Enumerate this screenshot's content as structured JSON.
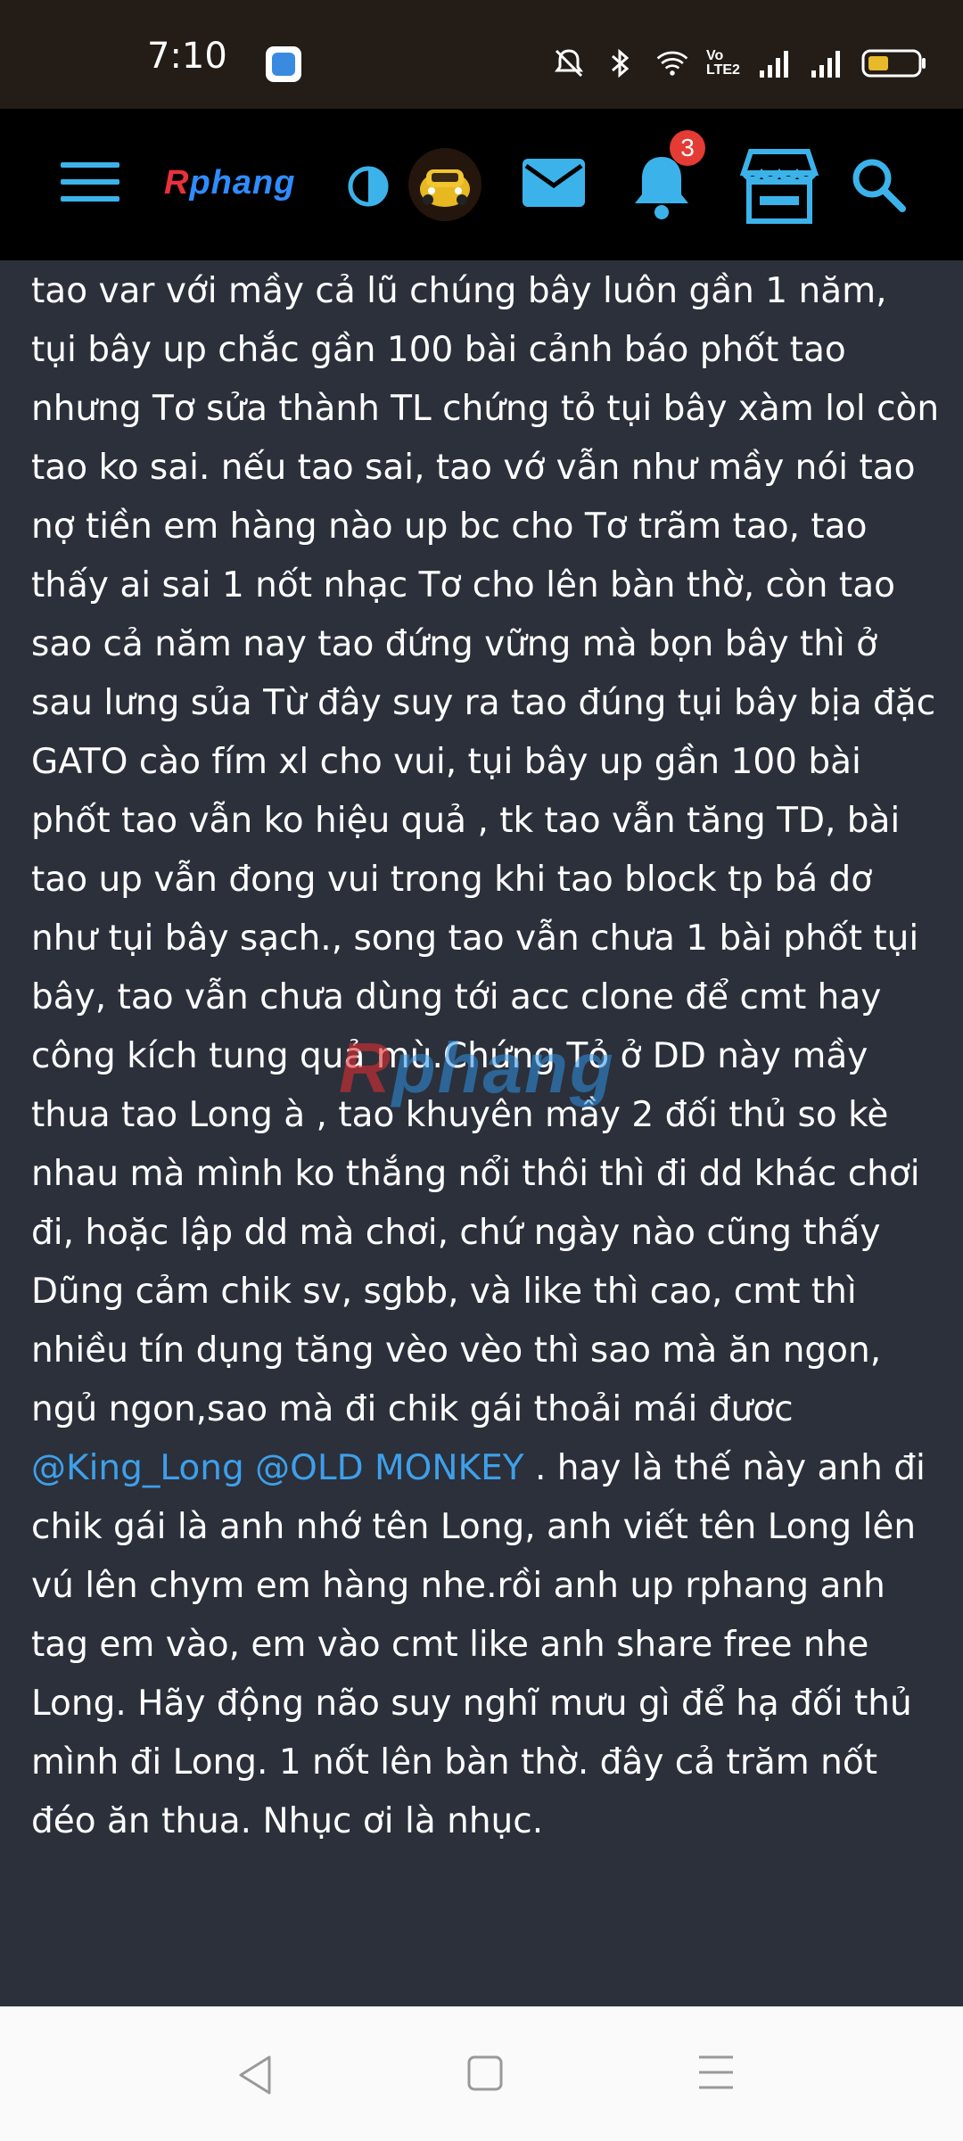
{
  "status_bar": {
    "time": "7:10",
    "network_label": "Vo LTE2",
    "icons": [
      "mute-icon",
      "bluetooth-icon",
      "wifi-icon",
      "volte-icon",
      "signal-icon",
      "signal-icon",
      "battery-icon"
    ]
  },
  "header": {
    "logo": "Rphang",
    "logo_first": "R",
    "logo_rest": "phang",
    "notification_count": "3",
    "accent_color": "#3bb3ea",
    "icons": [
      "menu-icon",
      "contrast-icon",
      "avatar",
      "mail-icon",
      "bell-icon",
      "store-icon",
      "search-icon"
    ]
  },
  "post": {
    "text_before": "tao var với mầy cả lũ chúng bây luôn gần 1 năm, tụi bây up chắc gần 100 bài cảnh báo phốt tao nhưng Tơ sửa thành TL chứng tỏ tụi bây xàm lol còn tao ko sai. nếu tao sai, tao vớ vẫn như mầy nói tao nợ tiền em hàng nào up bc cho Tơ trãm tao, tao thấy ai sai 1 nốt nhạc Tơ cho lên bàn thờ, còn tao sao cả năm nay tao đứng vững mà bọn bây thì ở sau lưng sủa Từ đây suy ra tao đúng tụi bây bịa đặc GATO cào fím xl cho vui, tụi bây up gần 100 bài phốt tao vẫn ko hiệu quả , tk tao vẫn tăng TD, bài tao up vẫn đong vui trong khi tao block tp bá dơ như tụi bây sạch., song tao vẫn chưa 1 bài phốt tụi bây, tao vẫn chưa dùng tới acc clone để cmt hay công kích tung quả mù.Chứng Tỏ ở DD này mầy thua tao Long à , tao khuyên mầy 2 đối thủ so kè nhau mà mình ko thắng nổi thôi thì đi dd khác chơi đi, hoặc lập dd mà chơi, chứ ngày nào cũng thấy Dũng cảm chik sv, sgbb, và like thì cao, cmt thì nhiều tín dụng tăng vèo vèo thì sao mà ăn ngon, ngủ ngon,sao mà đi chik gái thoải mái đươc ",
    "mention_1": "@King_Long",
    "mention_2": "@OLD MONKEY",
    "text_after": " . hay là thế này anh đi chik gái là anh nhớ tên Long, anh viết tên Long lên vú lên chym em hàng nhe.rồi anh up rphang anh tag em vào, em vào cmt like anh share free nhe Long. Hãy động não suy nghĩ mưu gì để hạ đối thủ mình đi Long. 1 nốt lên bàn thờ. đây cả trăm nốt đéo ăn thua. Nhục ơi là nhục.",
    "watermark_first": "R",
    "watermark_rest": "phang",
    "mention_color": "#3ea0ea"
  },
  "nav_bar": {
    "icons": [
      "back-icon",
      "home-icon",
      "recents-icon"
    ]
  }
}
